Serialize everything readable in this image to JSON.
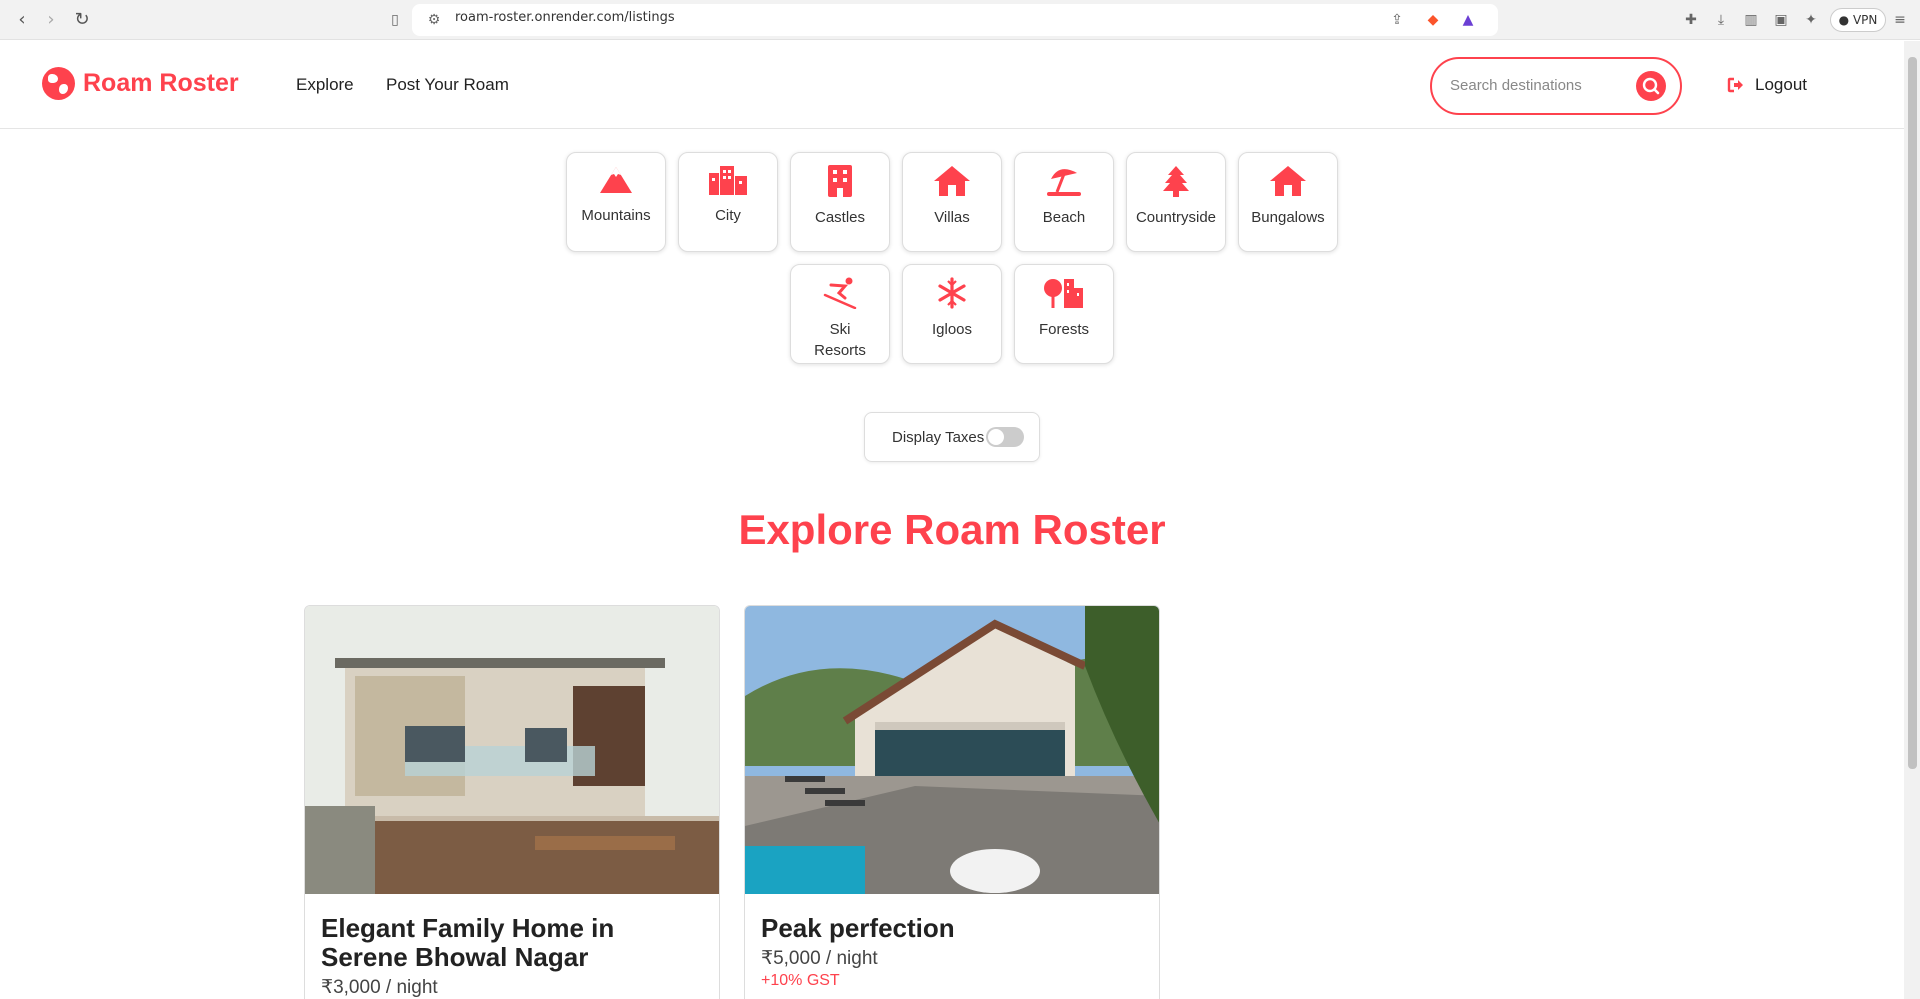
{
  "browser": {
    "url": "roam-roster.onrender.com/listings",
    "vpn_label": "VPN"
  },
  "navbar": {
    "brand": "Roam Roster",
    "links": [
      "Explore",
      "Post Your Roam"
    ],
    "search_placeholder": "Search destinations",
    "logout_label": "Logout"
  },
  "filters": [
    {
      "label": "Mountains",
      "icon": "mountain-icon"
    },
    {
      "label": "City",
      "icon": "city-icon"
    },
    {
      "label": "Castles",
      "icon": "castle-icon"
    },
    {
      "label": "Villas",
      "icon": "house-icon"
    },
    {
      "label": "Beach",
      "icon": "umbrella-beach-icon"
    },
    {
      "label": "Countryside",
      "icon": "tree-icon"
    },
    {
      "label": "Bungalows",
      "icon": "house-icon"
    },
    {
      "label": "Ski Resorts",
      "icon": "skiing-icon"
    },
    {
      "label": "Igloos",
      "icon": "snowflake-icon"
    },
    {
      "label": "Forests",
      "icon": "tree-city-icon"
    }
  ],
  "tax_toggle": {
    "label": "Display Taxes",
    "on": false
  },
  "heading": "Explore Roam Roster",
  "listings": [
    {
      "title": "Elegant Family Home in Serene Bhowal Nagar",
      "price": "₹3,000",
      "per": " / night",
      "gst": ""
    },
    {
      "title": "Peak perfection",
      "price": "₹5,000",
      "per": " / night",
      "gst": "+10% GST"
    }
  ],
  "colors": {
    "accent": "#fe424d"
  }
}
